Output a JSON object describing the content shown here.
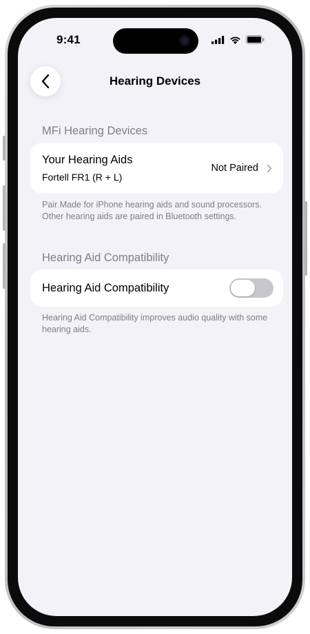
{
  "status_bar": {
    "time": "9:41",
    "icons": [
      "cellular-signal-icon",
      "wifi-icon",
      "battery-icon"
    ]
  },
  "nav": {
    "back_icon": "chevron-left-icon",
    "title": "Hearing Devices"
  },
  "mfi_section": {
    "header": "MFi Hearing Devices",
    "row": {
      "title": "Your Hearing Aids",
      "subtitle": "Fortell FR1 (R + L)",
      "value": "Not Paired",
      "icon": "chevron-right-icon"
    },
    "footnote": "Pair Made for iPhone hearing aids and sound processors. Other hearing aids are paired in Bluetooth settings."
  },
  "hac_section": {
    "header": "Hearing Aid Compatibility",
    "row": {
      "label": "Hearing Aid Compatibility",
      "toggle_on": false
    },
    "footnote": "Hearing Aid Compatibility improves audio quality with some hearing aids."
  },
  "colors": {
    "background": "#f2f2f7",
    "card": "#ffffff",
    "secondary_text": "#7e7e83",
    "toggle_off": "#c7c7cc"
  }
}
